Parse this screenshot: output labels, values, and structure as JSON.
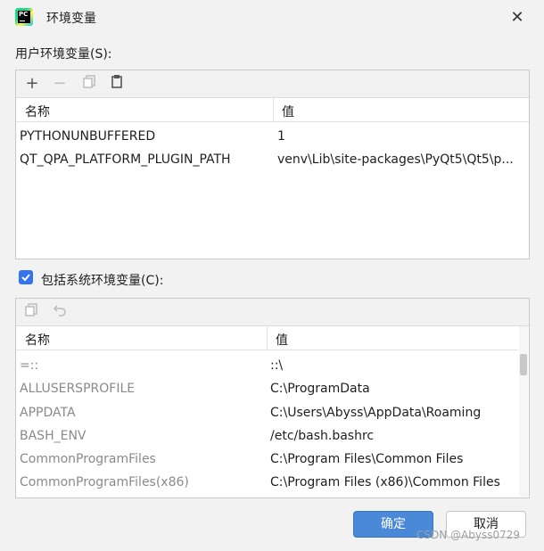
{
  "window": {
    "title": "环境变量",
    "close_icon": "close-icon"
  },
  "user_section": {
    "label": "用户环境变量(S):",
    "toolbar": [
      {
        "icon": "plus-icon",
        "glyph": "+"
      },
      {
        "icon": "minus-icon",
        "glyph": "−"
      },
      {
        "icon": "copy-icon",
        "glyph": "⧉"
      },
      {
        "icon": "paste-icon",
        "glyph": "📋"
      }
    ],
    "columns": [
      "名称",
      "值"
    ],
    "rows": [
      {
        "name": "PYTHONUNBUFFERED",
        "value": "1"
      },
      {
        "name": "QT_QPA_PLATFORM_PLUGIN_PATH",
        "value": "venv\\Lib\\site-packages\\PyQt5\\Qt5\\p..."
      }
    ]
  },
  "system_section": {
    "checkbox_label": "包括系统环境变量(C):",
    "checked": true,
    "toolbar": [
      {
        "icon": "copy-icon"
      },
      {
        "icon": "undo-icon"
      }
    ],
    "columns": [
      "名称",
      "值"
    ],
    "rows": [
      {
        "name": "=::",
        "value": "::\\"
      },
      {
        "name": "ALLUSERSPROFILE",
        "value": "C:\\ProgramData"
      },
      {
        "name": "APPDATA",
        "value": "C:\\Users\\Abyss\\AppData\\Roaming"
      },
      {
        "name": "BASH_ENV",
        "value": "/etc/bash.bashrc"
      },
      {
        "name": "CommonProgramFiles",
        "value": "C:\\Program Files\\Common Files"
      },
      {
        "name": "CommonProgramFiles(x86)",
        "value": "C:\\Program Files (x86)\\Common Files"
      }
    ]
  },
  "buttons": {
    "ok": "确定",
    "cancel": "取消"
  },
  "watermark": "CSDN @Abyss0729",
  "colors": {
    "accent": "#4a88d8",
    "checkbox": "#3574f0"
  }
}
